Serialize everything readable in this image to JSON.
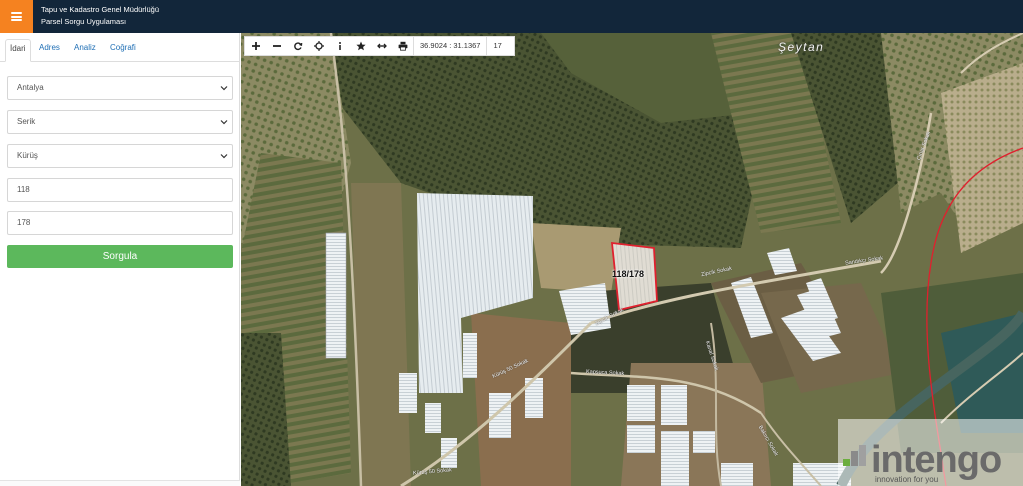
{
  "header": {
    "title_line1": "Tapu ve Kadastro Genel Müdürlüğü",
    "title_line2": "Parsel Sorgu Uygulaması"
  },
  "sidebar": {
    "tabs": [
      {
        "label": "İdari"
      },
      {
        "label": "Adres"
      },
      {
        "label": "Analiz"
      },
      {
        "label": "Coğrafi"
      }
    ],
    "province": "Antalya",
    "district": "Serik",
    "neighborhood": "Kürüş",
    "block_no": "118",
    "parcel_no": "178",
    "query_label": "Sorgula"
  },
  "toolbar": {
    "coordinates": "36.9024 : 31.1367",
    "zoom": "17"
  },
  "map": {
    "place_name": "Şeytan",
    "parcel_label": "118/178",
    "parcel_color": "#e0202e",
    "streets": [
      "Zipcik Sokak",
      "Zipcik Sokak",
      "Sandıkçı Sokak",
      "Kapsuca Sokak",
      "Kürüş 50 Sokak",
      "Kürüş 50 Sokak",
      "Kanal Sokak",
      "Bakırcı Sokak",
      "Çınar Sokak"
    ]
  },
  "watermark": {
    "brand": "intengo",
    "tagline": "innovation for you"
  },
  "colors": {
    "header_bg": "#12263a",
    "menu_button": "#f58220",
    "query_button": "#5cb85c",
    "tab_link": "#1f6fb5"
  }
}
